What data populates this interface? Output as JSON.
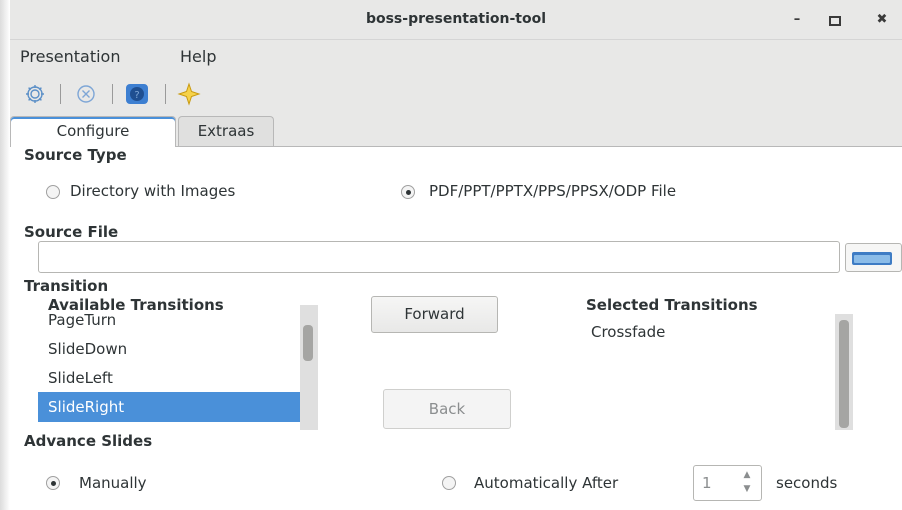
{
  "window": {
    "title": "boss-presentation-tool",
    "minimize": "–",
    "maximize": "▫",
    "close": "✖"
  },
  "menu": [
    "Presentation",
    "Help"
  ],
  "toolbar": {
    "icons": [
      "gear-icon",
      "cancel-icon",
      "help-icon",
      "star-icon"
    ],
    "colors": {
      "gear": "#5b8fc7",
      "help": "#1f4f91",
      "star": "#f0c419"
    }
  },
  "tabs": {
    "configure": "Configure",
    "extras": "Extraas"
  },
  "source_type": {
    "heading": "Source Type",
    "option_dir": "Directory with Images",
    "option_file": "PDF/PPT/PPTX/PPS/PPSX/ODP File",
    "selected": "file"
  },
  "source_file": {
    "heading": "Source File",
    "value": ""
  },
  "transition": {
    "heading": "Transition",
    "available_heading": "Available Transitions",
    "available_items": [
      "PageTurn",
      "SlideDown",
      "SlideLeft",
      "SlideRight"
    ],
    "available_selected": "SlideRight",
    "forward_label": "Forward",
    "back_label": "Back",
    "selected_heading": "Selected Transitions",
    "selected_items": [
      "Crossfade"
    ]
  },
  "advance": {
    "heading": "Advance Slides",
    "manual_label": "Manually",
    "auto_label": "Automatically After",
    "seconds_value": "1",
    "seconds_label": "seconds",
    "selected": "manual"
  },
  "colors": {
    "accent": "#4a90d9",
    "chrome": "#e8e8e7"
  }
}
